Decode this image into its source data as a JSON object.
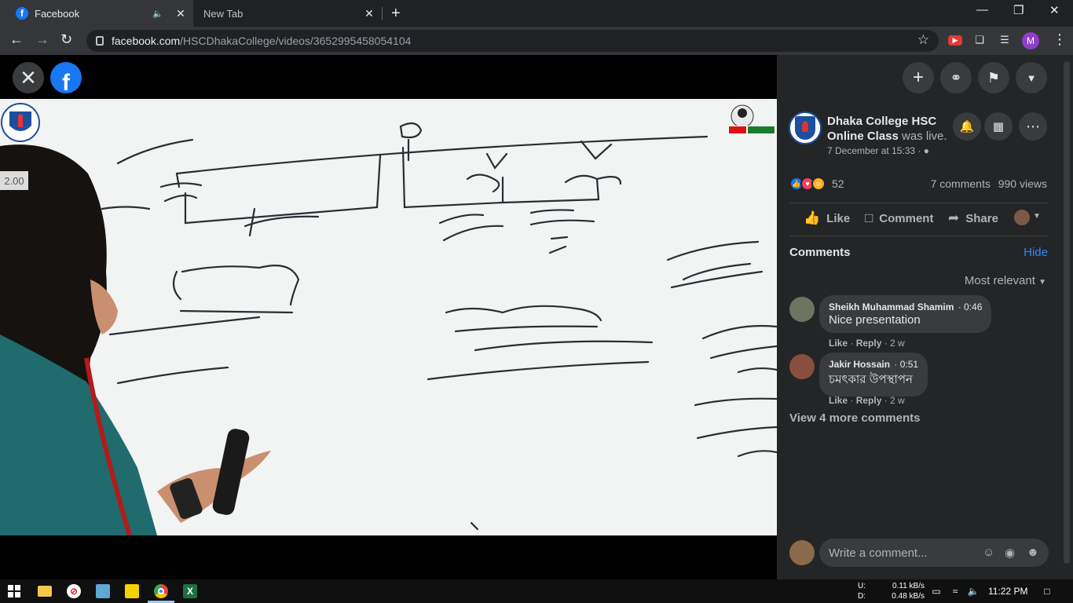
{
  "browser": {
    "tabs": [
      {
        "title": "Facebook",
        "active": true
      },
      {
        "title": "New Tab",
        "active": false
      }
    ],
    "url_domain": "facebook.com",
    "url_path": "/HSCDhakaCollege/videos/3652995458054104",
    "profile_initial": "M"
  },
  "video": {
    "playback_speed": "2.00"
  },
  "post": {
    "page_name": "Dhaka College HSC Online Class",
    "status": "was live.",
    "timestamp": "7 December at 15:33 · ",
    "reaction_count": "52",
    "comment_count": "7 comments",
    "view_count": "990 views",
    "actions": {
      "like": "Like",
      "comment": "Comment",
      "share": "Share"
    }
  },
  "comments_section": {
    "heading": "Comments",
    "hide_label": "Hide",
    "sort_label": "Most relevant",
    "comments": [
      {
        "author": "Sheikh Muhammad Shamim",
        "time": "· 0:46",
        "text": "Nice presentation",
        "like": "Like",
        "reply": "Reply",
        "age": "2 w"
      },
      {
        "author": "Jakir Hossain",
        "time": "· 0:51",
        "text": "চমৎকার উপস্থাপন",
        "like": "Like",
        "reply": "Reply",
        "age": "2 w"
      }
    ],
    "view_more": "View 4 more comments",
    "write_placeholder": "Write a comment..."
  },
  "taskbar": {
    "upload_label": "U:",
    "download_label": "D:",
    "upload_rate": "0.11 kB/s",
    "download_rate": "0.48 kB/s",
    "time": "11:22 PM"
  },
  "colors": {
    "facebook_blue": "#1877f2",
    "panel_bg": "#242526",
    "link_blue": "#2d88ff"
  }
}
